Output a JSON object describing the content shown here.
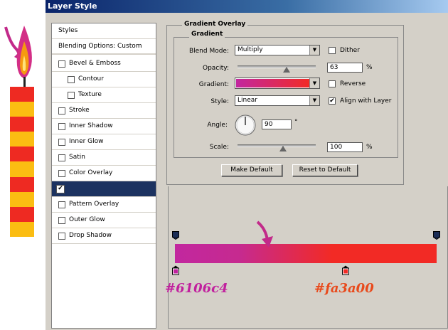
{
  "dialog": {
    "title": "Layer Style"
  },
  "styles_list": [
    {
      "label": "Styles",
      "type": "header",
      "checked": false
    },
    {
      "label": "Blending Options: Custom",
      "type": "header",
      "checked": false
    },
    {
      "label": "Bevel & Emboss",
      "type": "item",
      "checked": false
    },
    {
      "label": "Contour",
      "type": "subitem",
      "checked": false
    },
    {
      "label": "Texture",
      "type": "subitem",
      "checked": false
    },
    {
      "label": "Stroke",
      "type": "item",
      "checked": false
    },
    {
      "label": "Inner Shadow",
      "type": "item",
      "checked": false
    },
    {
      "label": "Inner Glow",
      "type": "item",
      "checked": false
    },
    {
      "label": "Satin",
      "type": "item",
      "checked": false
    },
    {
      "label": "Color Overlay",
      "type": "item",
      "checked": false
    },
    {
      "label": "",
      "type": "item",
      "checked": true,
      "selected": true
    },
    {
      "label": "Pattern Overlay",
      "type": "item",
      "checked": false
    },
    {
      "label": "Outer Glow",
      "type": "item",
      "checked": false
    },
    {
      "label": "Drop Shadow",
      "type": "item",
      "checked": false
    }
  ],
  "gradient_overlay": {
    "section_title": "Gradient Overlay",
    "group_title": "Gradient",
    "blend_mode": {
      "label": "Blend Mode:",
      "value": "Multiply"
    },
    "dither": {
      "label": "Dither",
      "checked": false
    },
    "opacity": {
      "label": "Opacity:",
      "value": "63",
      "unit": "%",
      "slider_fraction": 0.63
    },
    "gradient": {
      "label": "Gradient:"
    },
    "reverse": {
      "label": "Reverse",
      "checked": false
    },
    "style": {
      "label": "Style:",
      "value": "Linear"
    },
    "align_with_layer": {
      "label": "Align with Layer",
      "checked": true
    },
    "angle": {
      "label": "Angle:",
      "value": "90",
      "unit": "°"
    },
    "scale": {
      "label": "Scale:",
      "value": "100",
      "unit": "%",
      "slider_fraction": 0.58
    },
    "buttons": {
      "make_default": "Make Default",
      "reset_to_default": "Reset to Default"
    }
  },
  "gradient_editor": {
    "stops": [
      {
        "color_label": "#6106c4",
        "display_color": "#c1209e"
      },
      {
        "color_label": "#fa3a00",
        "display_color": "#f32a25"
      }
    ]
  },
  "colors": {
    "gradient_start": "#c2279f",
    "gradient_end": "#f22a25",
    "label_left": "#c1209e",
    "label_right": "#e84a1c",
    "candle_red": "#ee2a22",
    "candle_yellow": "#fbbd12",
    "flame_outer": "#c22a8a",
    "flame_inner": "#f59a10"
  }
}
